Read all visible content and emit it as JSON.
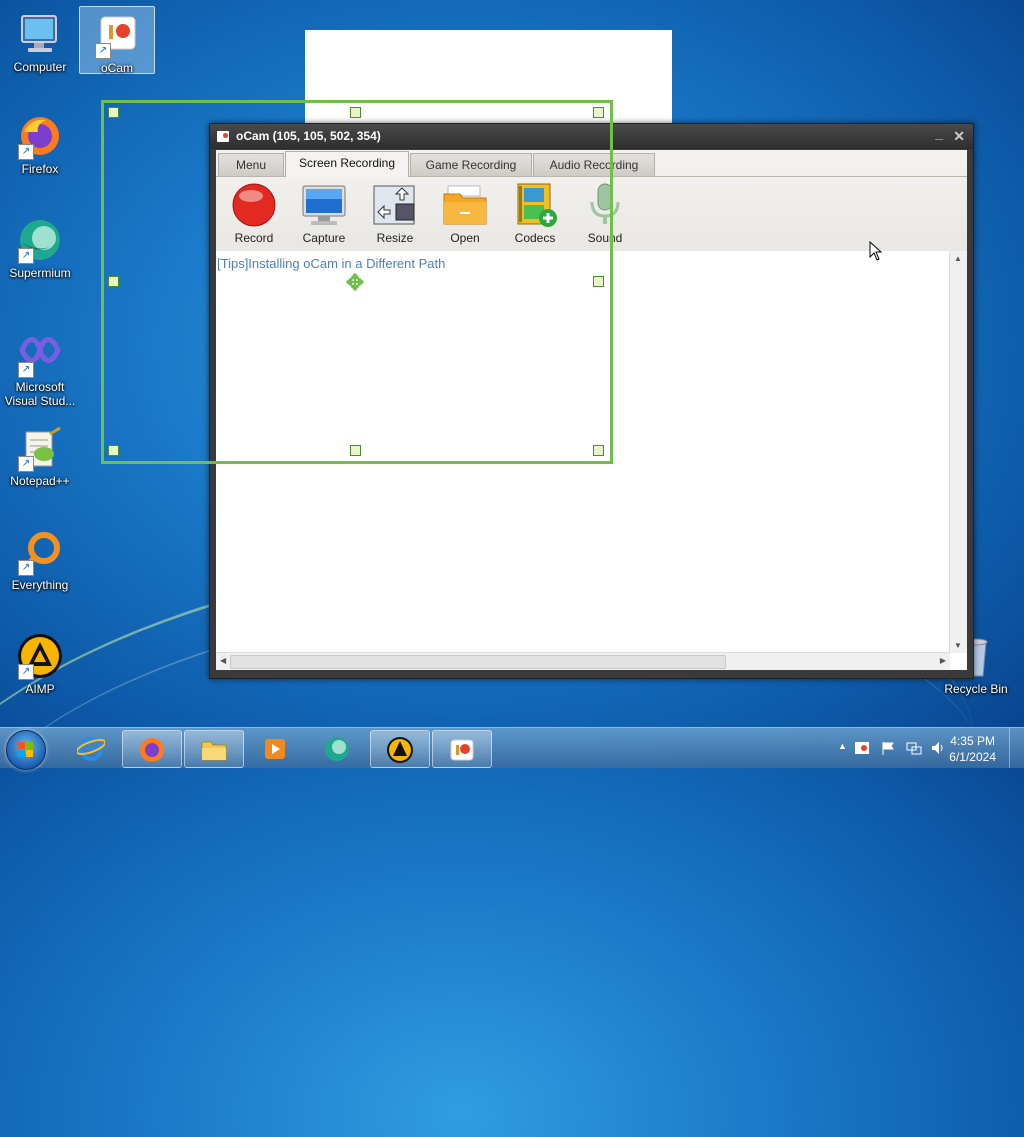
{
  "desktop": {
    "icons": [
      {
        "label": "Computer"
      },
      {
        "label": "oCam"
      },
      {
        "label": "Firefox"
      },
      {
        "label": "Supermium"
      },
      {
        "label": "Microsoft Visual Stud..."
      },
      {
        "label": "Notepad++"
      },
      {
        "label": "Everything"
      },
      {
        "label": "AIMP"
      },
      {
        "label": "Recycle Bin"
      }
    ]
  },
  "ocam": {
    "title": "oCam (105, 105, 502, 354)",
    "minimize": "_",
    "close": "✕",
    "tabs": [
      "Menu",
      "Screen Recording",
      "Game Recording",
      "Audio Recording"
    ],
    "active_tab": "Screen Recording",
    "tools": [
      "Record",
      "Capture",
      "Resize",
      "Open",
      "Codecs",
      "Sound"
    ],
    "tips": "[Tips]Installing oCam in a Different Path"
  },
  "taskbar": {
    "time": "4:35 PM",
    "date": "6/1/2024",
    "tray_chevron": "▲"
  },
  "colors": {
    "capture_border": "#6fbf4a",
    "tips_link": "#4a7fc0",
    "record_red": "#e32a22"
  }
}
